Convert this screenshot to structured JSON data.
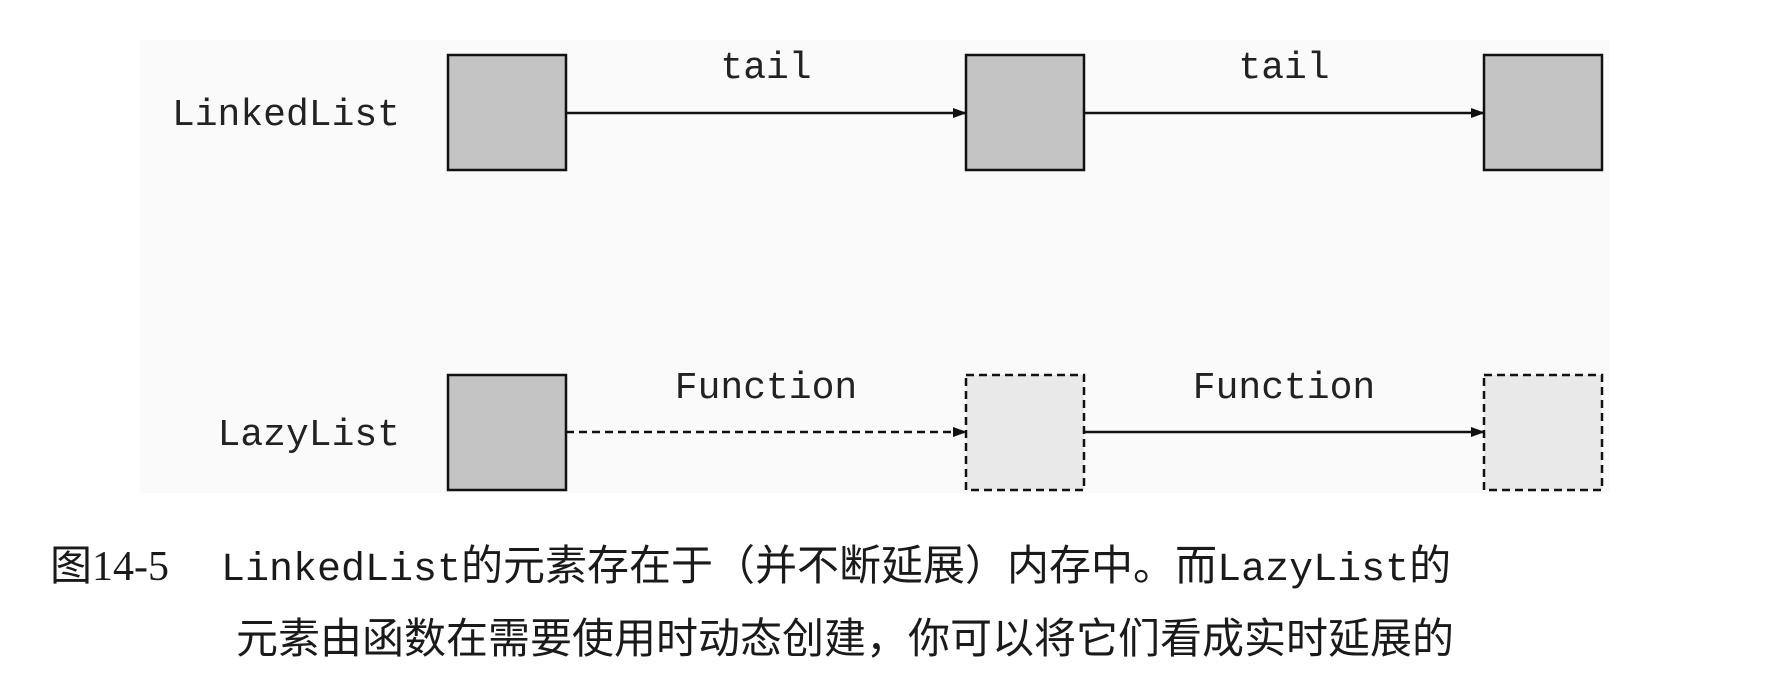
{
  "diagram": {
    "rows": [
      {
        "label": "LinkedList",
        "nodes": [
          "solid",
          "solid",
          "solid"
        ],
        "edges": [
          {
            "label": "tail",
            "style": "solid"
          },
          {
            "label": "tail",
            "style": "solid"
          }
        ]
      },
      {
        "label": "LazyList",
        "nodes": [
          "solid",
          "lazy",
          "lazy"
        ],
        "edges": [
          {
            "label": "Function",
            "style": "dashed"
          },
          {
            "label": "Function",
            "style": "solid"
          }
        ]
      }
    ],
    "colors": {
      "panel": "#fafafa",
      "node_solid": "#c4c4c4",
      "node_lazy": "#e9e9e9",
      "stroke": "#111111"
    }
  },
  "caption": {
    "figure_number": "图14-5",
    "parts": [
      {
        "text": "LinkedList",
        "kind": "code"
      },
      {
        "text": "的元素存在于（并不断延展）内存中。而",
        "kind": "text"
      },
      {
        "text": "LazyList",
        "kind": "code"
      },
      {
        "text": "的",
        "kind": "text"
      }
    ],
    "line2": "元素由函数在需要使用时动态创建，你可以将它们看成实时延展的"
  }
}
